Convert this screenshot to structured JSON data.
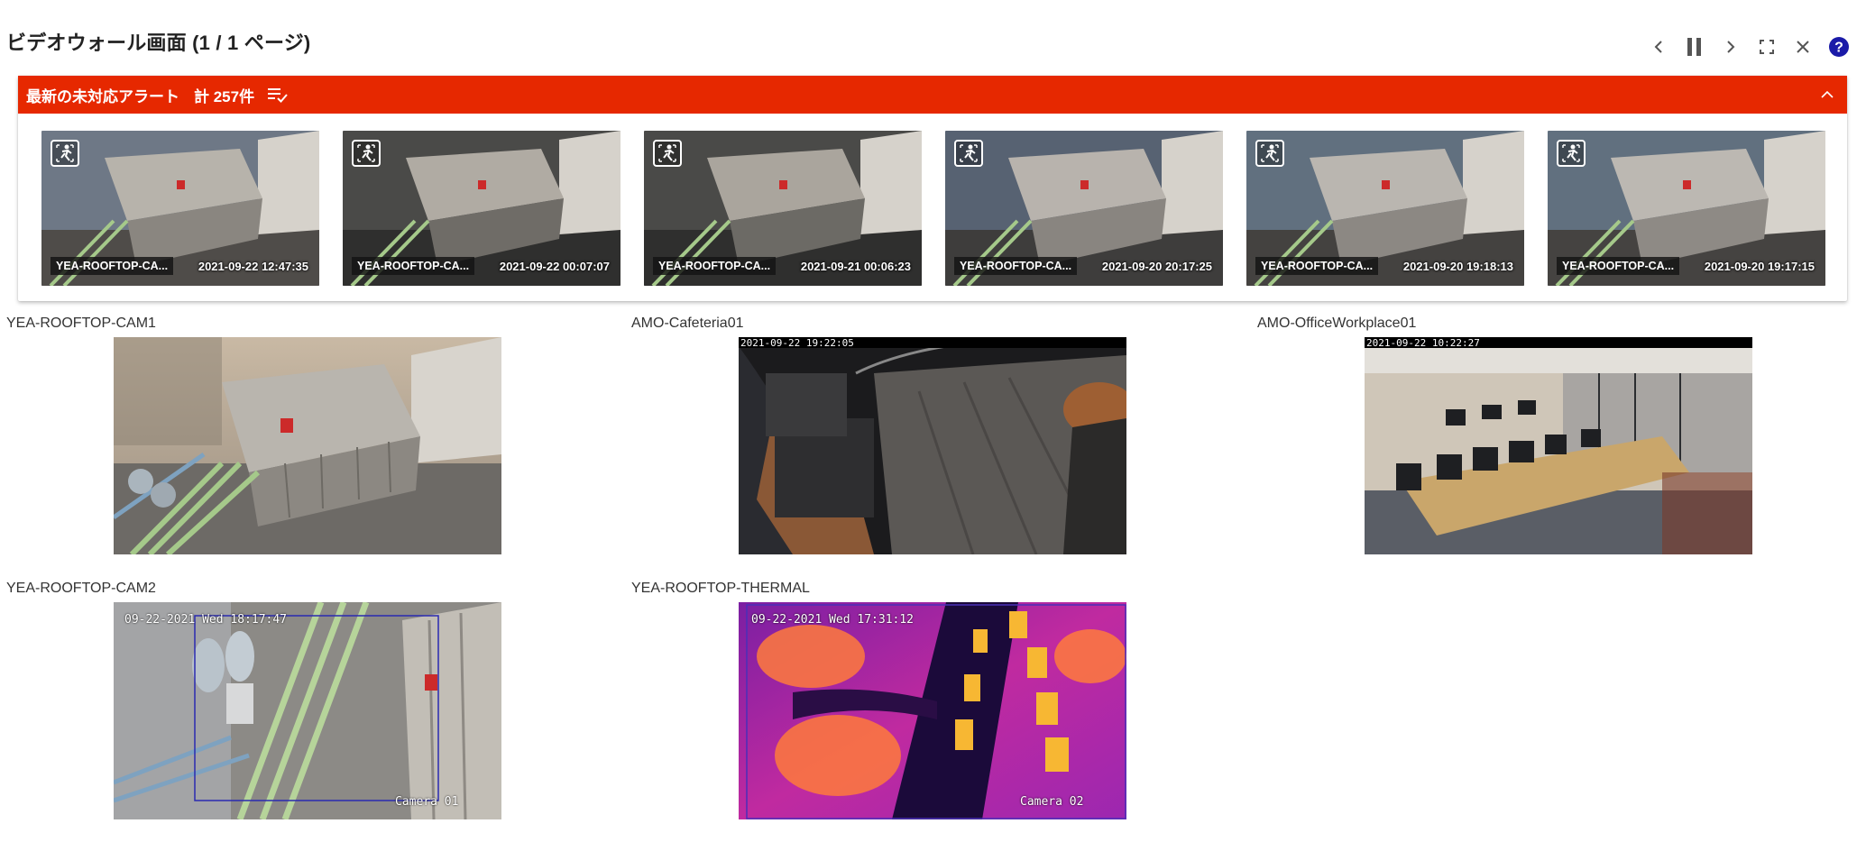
{
  "page": {
    "title": "ビデオウォール画面 (1 / 1 ページ)"
  },
  "toolbar": {
    "icons": [
      "chevron-left-icon",
      "pause-icon",
      "chevron-right-icon",
      "fullscreen-icon",
      "close-icon",
      "help-icon"
    ],
    "help_color": "#1a1aa8"
  },
  "alerts": {
    "title": "最新の未対応アラート",
    "count": "計 257件",
    "header_color": "#e62800",
    "items": [
      {
        "camera": "YEA-ROOFTOP-CA...",
        "time": "2021-09-22 12:47:35"
      },
      {
        "camera": "YEA-ROOFTOP-CA...",
        "time": "2021-09-22 00:07:07"
      },
      {
        "camera": "YEA-ROOFTOP-CA...",
        "time": "2021-09-21 00:06:23"
      },
      {
        "camera": "YEA-ROOFTOP-CA...",
        "time": "2021-09-20 20:17:25"
      },
      {
        "camera": "YEA-ROOFTOP-CA...",
        "time": "2021-09-20 19:18:13"
      },
      {
        "camera": "YEA-ROOFTOP-CA...",
        "time": "2021-09-20 19:17:15"
      }
    ]
  },
  "cameras": [
    {
      "name": "YEA-ROOFTOP-CAM1",
      "osd_top": "",
      "osd_bottom": ""
    },
    {
      "name": "AMO-Cafeteria01",
      "osd_top": "2021-09-22 19:22:05",
      "osd_bottom": ""
    },
    {
      "name": "AMO-OfficeWorkplace01",
      "osd_top": "2021-09-22 10:22:27",
      "osd_bottom": ""
    },
    {
      "name": "YEA-ROOFTOP-CAM2",
      "osd_top": "09-22-2021 Wed 18:17:47",
      "osd_bottom": "Camera 01"
    },
    {
      "name": "YEA-ROOFTOP-THERMAL",
      "osd_top": "09-22-2021 Wed 17:31:12",
      "osd_bottom": "Camera 02"
    }
  ]
}
